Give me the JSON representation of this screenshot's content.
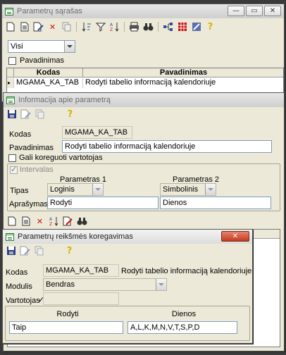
{
  "win1": {
    "title": "Parametrų sąrašas",
    "filter_value": "Visi",
    "pavadinimas_checkbox": "Pavadinimas",
    "table": {
      "headers": [
        "Kodas",
        "Pavadinimas"
      ],
      "rows": [
        {
          "marker": "▸",
          "kodas": "MGAMA_KA_TAB",
          "pavadinimas": "Rodyti tabelio informaciją kalendoriuje"
        }
      ]
    }
  },
  "win2": {
    "title": "Informacija apie parametrą",
    "kodas_label": "Kodas",
    "kodas_value": "MGAMA_KA_TAB",
    "pavadinimas_label": "Pavadinimas",
    "pavadinimas_value": "Rodyti tabelio informaciją kalendoriuje",
    "gali_koreguoti_label": "Gali koreguoti vartotojas",
    "intervalas_label": "Intervalas",
    "parametras1_label": "Parametras 1",
    "parametras2_label": "Parametras 2",
    "tipas_label": "Tipas",
    "tipas1_value": "Loginis",
    "tipas2_value": "Simbolinis",
    "aprasymas_label": "Aprašymas",
    "aprasymas1_value": "Rodyti",
    "aprasymas2_value": "Dienos"
  },
  "win3": {
    "title": "Parametrų reikšmės koregavimas",
    "kodas_label": "Kodas",
    "kodas_value": "MGAMA_KA_TAB",
    "kodas_description": "Rodyti tabelio informaciją kalendoriuje",
    "modulis_label": "Modulis",
    "modulis_value": "Bendras",
    "vartotojas_label": "Vartotojas",
    "vartotojas_check": "✓",
    "col1_header": "Rodyti",
    "col2_header": "Dienos",
    "col1_value": "Taip",
    "col2_value": "A,L,K,M,N,V,T,S,P,D"
  },
  "icons": {
    "minimize": "—",
    "maximize": "▭",
    "close": "✕",
    "help": "?"
  }
}
